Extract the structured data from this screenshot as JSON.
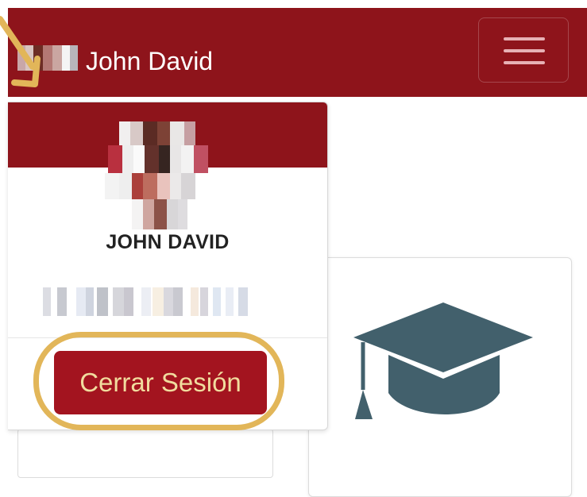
{
  "navbar": {
    "username": "John David",
    "menu_icon": "hamburger-menu-icon",
    "background_color": "#8e141b"
  },
  "profile_dropdown": {
    "name": "JOHN DAVID",
    "logout_label": "Cerrar Sesión",
    "logout_color": "#a3141f",
    "photo": "pixelated-profile-photo",
    "info": "pixelated-info-text"
  },
  "dashboard": {
    "card_icon": "graduation-cap-icon",
    "icon_color": "#42606c"
  },
  "annotations": {
    "arrow_color": "#e2b659",
    "highlight_target": "logout-button"
  }
}
